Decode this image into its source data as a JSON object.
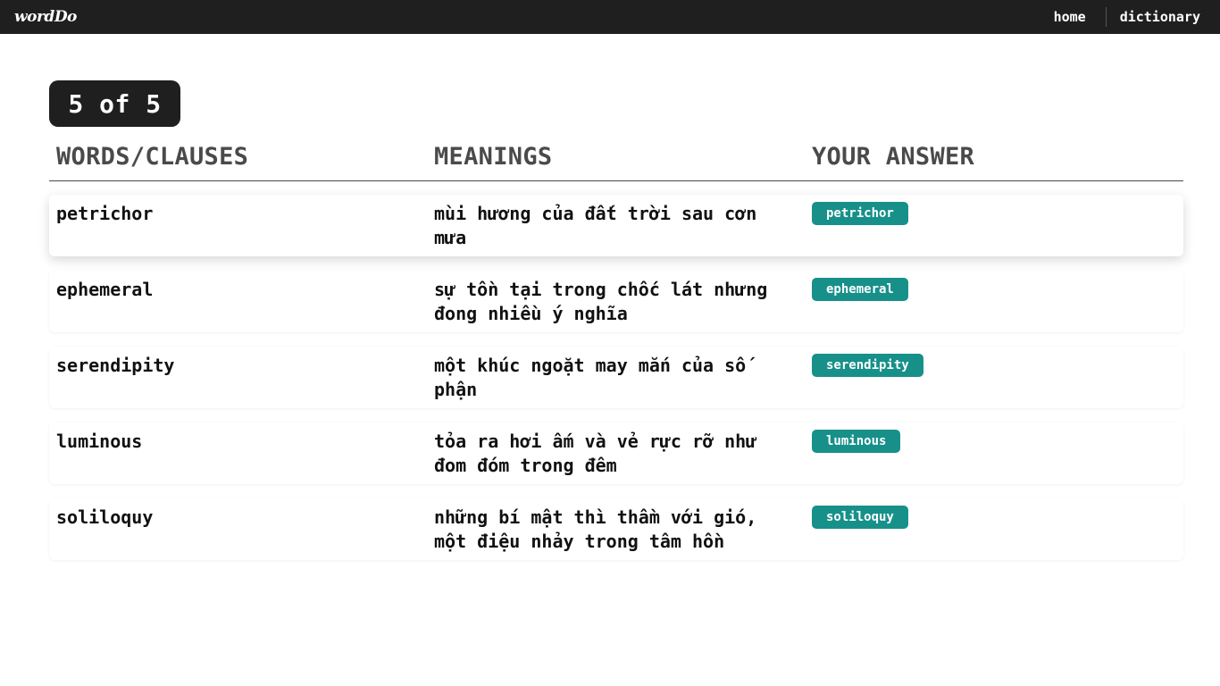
{
  "app": {
    "logo": "wordDo"
  },
  "nav": {
    "home": "home",
    "dictionary": "dictionary"
  },
  "progress": {
    "label": "5 of 5"
  },
  "table": {
    "headers": {
      "words": "WORDS/CLAUSES",
      "meanings": "MEANINGS",
      "answer": "YOUR ANSWER"
    },
    "rows": [
      {
        "word": "petrichor",
        "meaning": "mùi hương của đất trời sau cơn mưa",
        "answer": "petrichor"
      },
      {
        "word": "ephemeral",
        "meaning": "sự tồn tại trong chốc lát nhưng đong nhiều ý nghĩa",
        "answer": "ephemeral"
      },
      {
        "word": "serendipity",
        "meaning": "một khúc ngoặt may mắn của số phận",
        "answer": "serendipity"
      },
      {
        "word": "luminous",
        "meaning": "tỏa ra hơi ấm và vẻ rực rỡ như đom đóm trong đêm",
        "answer": "luminous"
      },
      {
        "word": "soliloquy",
        "meaning": "những bí mật thì thầm với gió, một điệu nhảy trong tâm hồn",
        "answer": "soliloquy"
      }
    ]
  },
  "colors": {
    "topbar": "#1f1f1f",
    "answer_badge": "#17908a",
    "header_text": "#4a4a4a"
  }
}
